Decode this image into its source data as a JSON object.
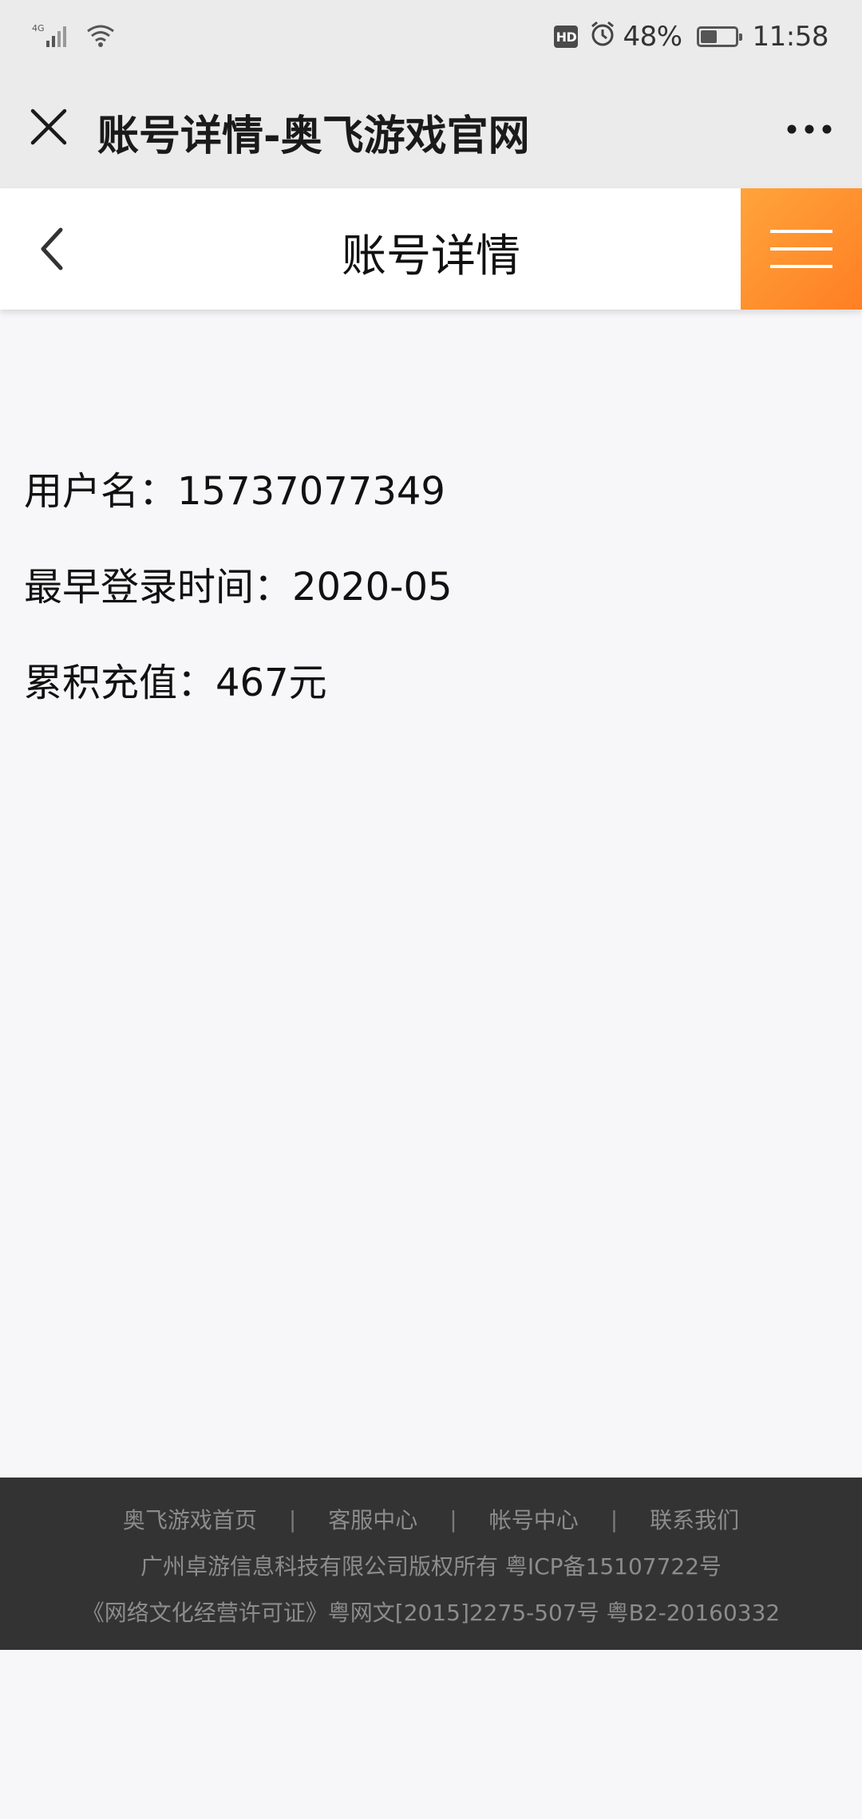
{
  "status_bar": {
    "network": "4G",
    "hd_label": "HD",
    "battery_text": "48%",
    "battery_level": 0.48,
    "time": "11:58",
    "icons": [
      "signal-icon",
      "wifi-icon",
      "hd-icon",
      "alarm-icon",
      "battery-icon"
    ]
  },
  "web_titlebar": {
    "title": "账号详情-奥飞游戏官网",
    "close_icon": "close-icon",
    "more_icon": "more-icon"
  },
  "page_header": {
    "title": "账号详情",
    "back_icon": "chevron-left-icon",
    "menu_icon": "hamburger-icon",
    "menu_color": "#ff8a2a"
  },
  "account_info": [
    {
      "label": "用户名：",
      "value": "15737077349"
    },
    {
      "label": "最早登录时间：",
      "value": "2020-05"
    },
    {
      "label": "累积充值：",
      "value": "467元"
    }
  ],
  "footer": {
    "links": [
      "奥飞游戏首页",
      "客服中心",
      "帐号中心",
      "联系我们"
    ],
    "separator": "|",
    "copyright": "广州卓游信息科技有限公司版权所有 粤ICP备15107722号",
    "license": "《网络文化经营许可证》粤网文[2015]2275-507号 粤B2-20160332",
    "background": "#333333"
  }
}
